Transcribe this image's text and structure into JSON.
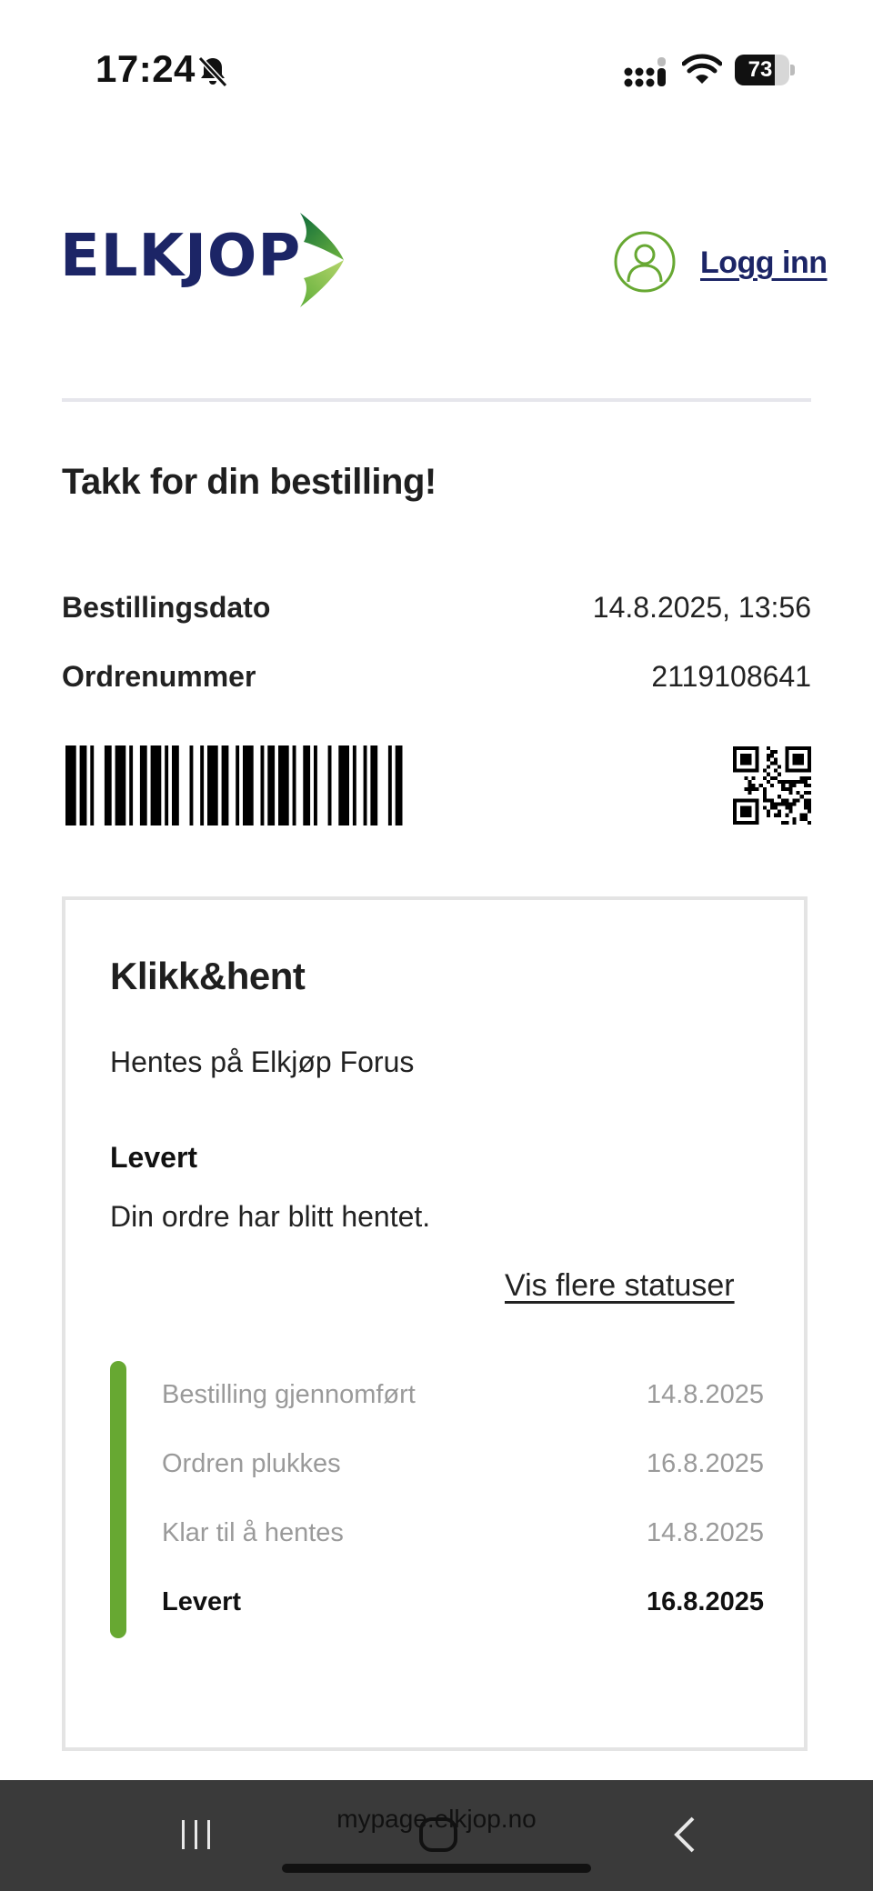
{
  "status_bar": {
    "time": "17:24",
    "battery_level": "73",
    "icons": [
      "bell-muted-icon",
      "signal-icon",
      "wifi-icon",
      "battery-icon"
    ]
  },
  "header": {
    "logo_text": "ELKJOP",
    "login_label": "Logg inn",
    "brand_color": "#1c2566",
    "accent_color": "#67a832"
  },
  "order": {
    "title": "Takk for din bestilling!",
    "date_label": "Bestillingsdato",
    "date_value": "14.8.2025, 13:56",
    "number_label": "Ordrenummer",
    "number_value": "2119108641"
  },
  "pickup": {
    "title": "Klikk&hent",
    "store": "Hentes på Elkjøp Forus",
    "status_title": "Levert",
    "status_desc": "Din ordre har blitt hentet.",
    "more_link": "Vis flere statuser",
    "timeline": [
      {
        "label": "Bestilling gjennomført",
        "date": "14.8.2025"
      },
      {
        "label": "Ordren plukkes",
        "date": "16.8.2025"
      },
      {
        "label": "Klar til å hentes",
        "date": "14.8.2025"
      },
      {
        "label": "Levert",
        "date": "16.8.2025"
      }
    ]
  },
  "browser": {
    "url": "mypage.elkjop.no"
  }
}
